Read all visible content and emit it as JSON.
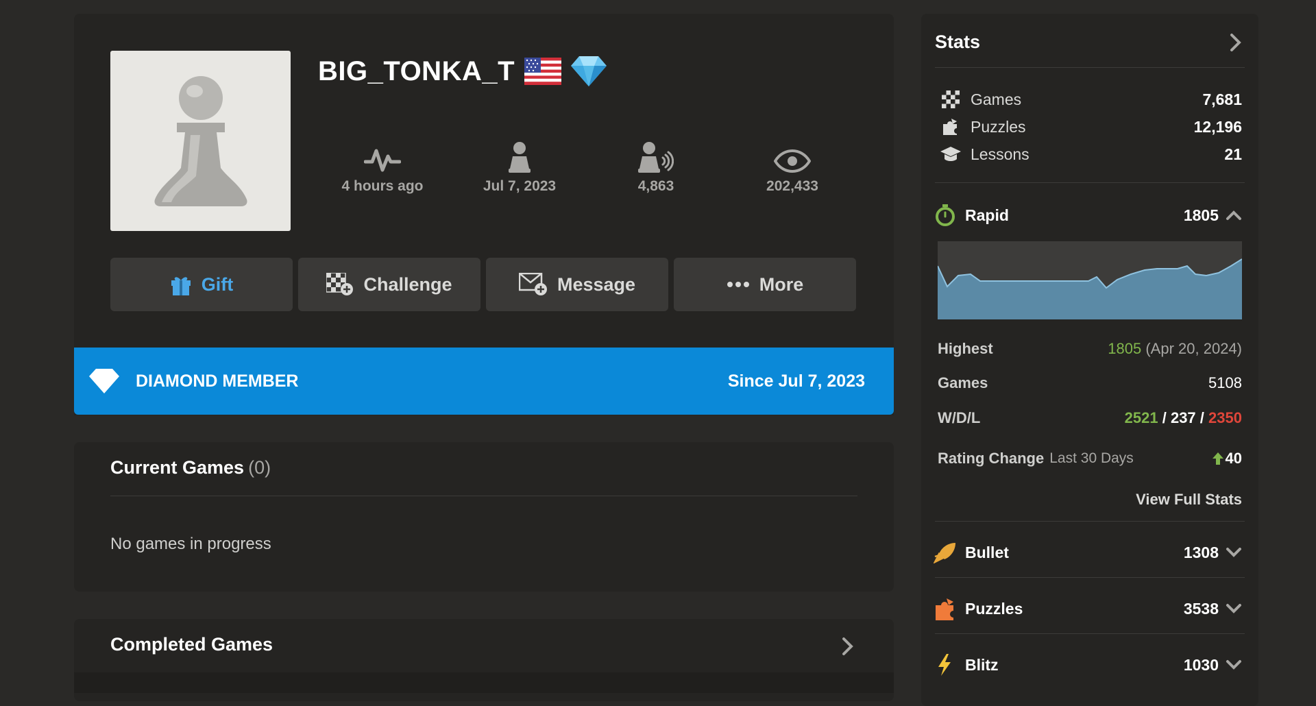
{
  "profile": {
    "username": "BIG_TONKA_T",
    "stats": [
      {
        "label": "4 hours ago",
        "icon": "activity-icon"
      },
      {
        "label": "Jul 7, 2023",
        "icon": "joined-icon"
      },
      {
        "label": "4,863",
        "icon": "followers-icon"
      },
      {
        "label": "202,433",
        "icon": "views-icon"
      }
    ],
    "actions": {
      "gift": "Gift",
      "challenge": "Challenge",
      "message": "Message",
      "more": "More"
    }
  },
  "membership": {
    "title": "DIAMOND MEMBER",
    "since": "Since Jul 7, 2023"
  },
  "current_games": {
    "title": "Current Games",
    "count": "(0)",
    "empty_text": "No games in progress"
  },
  "completed_games": {
    "title": "Completed Games"
  },
  "stats": {
    "title": "Stats",
    "summary": [
      {
        "name": "Games",
        "value": "7,681"
      },
      {
        "name": "Puzzles",
        "value": "12,196"
      },
      {
        "name": "Lessons",
        "value": "21"
      }
    ],
    "rapid": {
      "name": "Rapid",
      "rating": "1805",
      "highest_label": "Highest",
      "highest_value": "1805",
      "highest_date": "(Apr 20, 2024)",
      "games_label": "Games",
      "games_value": "5108",
      "wdl_label": "W/D/L",
      "wins": "2521",
      "draws": "237",
      "losses": "2350",
      "wdl_sep": "/",
      "rating_change_label": "Rating Change",
      "rating_change_period": "Last 30 Days",
      "rating_change_value": "40",
      "view_full_stats": "View Full Stats"
    },
    "categories": [
      {
        "name": "Bullet",
        "rating": "1308"
      },
      {
        "name": "Puzzles",
        "rating": "3538"
      },
      {
        "name": "Blitz",
        "rating": "1030"
      }
    ]
  },
  "colors": {
    "accent_blue": "#0b89d8",
    "win_green": "#81b64c",
    "loss_red": "#e0463a",
    "panel_bg": "#252422",
    "page_bg": "#2a2927"
  }
}
